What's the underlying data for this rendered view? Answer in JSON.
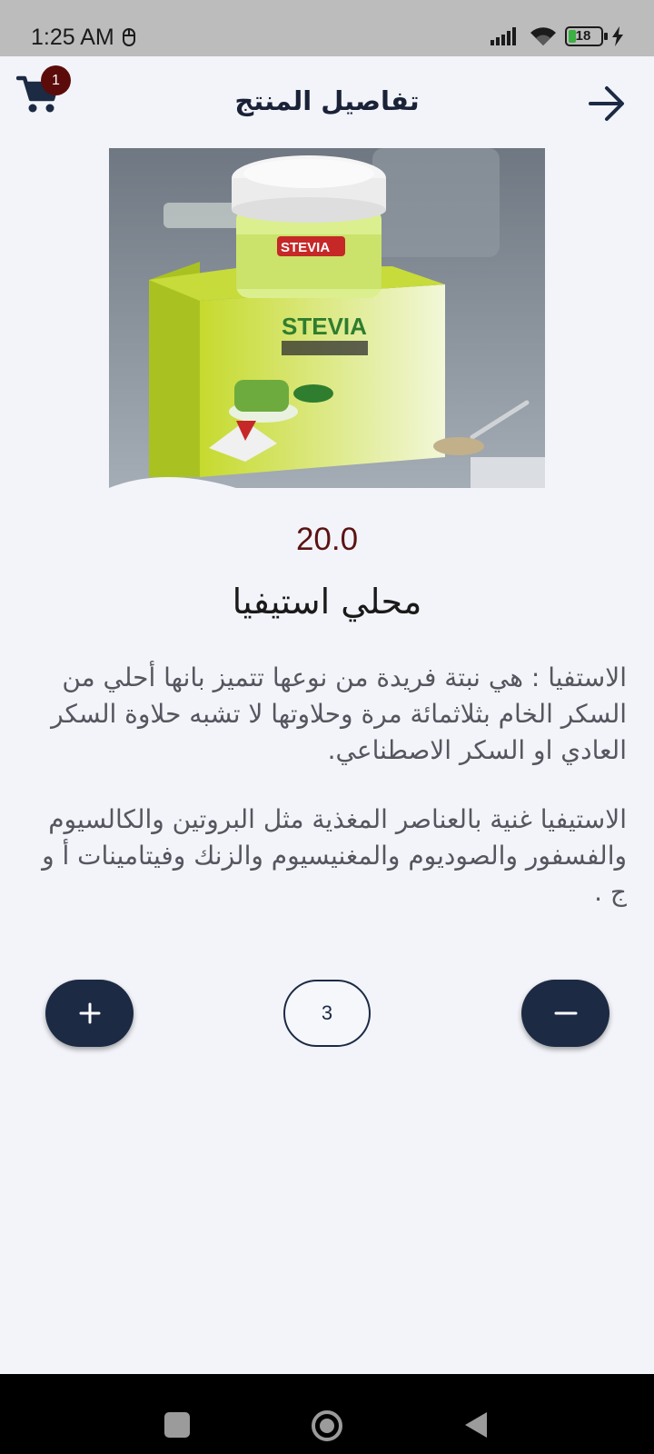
{
  "status_bar": {
    "time": "1:25 AM",
    "battery_level": "18"
  },
  "header": {
    "title": "تفاصيل المنتج",
    "cart_count": "1"
  },
  "product": {
    "image_alt": "محلي استيفيا",
    "price": "20.0",
    "name": "محلي استيفيا",
    "description_p1": "الاستفيا : هي نبتة فريدة من نوعها تتميز بانها أحلي من السكر الخام بثلاثمائة مرة وحلاوتها لا تشبه حلاوة السكر العادي او السكر الاصطناعي.",
    "description_p2": "الاستيفيا غنية بالعناصر المغذية مثل البروتين والكالسيوم والفسفور والصوديوم والمغنيسيوم والزنك وفيتامينات أ و ج ."
  },
  "quantity": {
    "value": "3"
  },
  "colors": {
    "background": "#f3f4f9",
    "primary": "#1c2a44",
    "price": "#5c1313",
    "badge": "#5c0b0b"
  },
  "icons": {
    "cart": "cart-icon",
    "back": "arrow-right-icon",
    "plus": "plus-icon",
    "minus": "minus-icon"
  }
}
